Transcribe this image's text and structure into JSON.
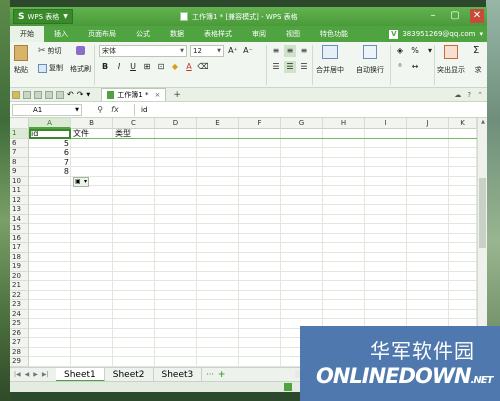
{
  "app": {
    "button_logo": "S",
    "button_label": "WPS 表格",
    "window_title": "工作簿1 * [兼容模式] - WPS 表格"
  },
  "window_controls": {
    "minimize": "–",
    "maximize": "▢",
    "close": "✕"
  },
  "menu": {
    "tabs": [
      "开始",
      "插入",
      "页面布局",
      "公式",
      "数据",
      "表格样式",
      "审阅",
      "视图",
      "特色功能"
    ],
    "active_tab": 0,
    "account_badge": "V",
    "account": "383951269@qq.com"
  },
  "ribbon": {
    "paste": "粘贴",
    "cut": "剪切",
    "copy": "复制",
    "format_painter": "格式刷",
    "font_name": "宋体",
    "font_size": "12",
    "grow_font": "A⁺",
    "shrink_font": "A⁻",
    "bold": "B",
    "italic": "I",
    "underline": "U",
    "merge_center": "合并居中",
    "auto_wrap": "自动换行",
    "percent": "%",
    "highlight": "突出显示",
    "sum": "求"
  },
  "toolbar": {
    "doc_tab": "工作簿1 *",
    "doc_tab_close": "×",
    "new_tab": "+"
  },
  "formula_bar": {
    "name_box": "A1",
    "fx": "fx",
    "content": "id"
  },
  "grid": {
    "columns": [
      "A",
      "B",
      "C",
      "D",
      "E",
      "F",
      "G",
      "H",
      "I",
      "J",
      "K"
    ],
    "rows": [
      "1",
      "6",
      "7",
      "8",
      "9",
      "10",
      "11",
      "12",
      "13",
      "14",
      "15",
      "16",
      "17",
      "18",
      "19",
      "20",
      "21",
      "22",
      "23",
      "24",
      "25",
      "26",
      "27",
      "28",
      "29"
    ],
    "cells": {
      "A1": "id",
      "B1": "文件",
      "C1": "类型",
      "A6": "5",
      "A7": "6",
      "A8": "7",
      "A9": "8"
    }
  },
  "sheets": {
    "tabs": [
      "Sheet1",
      "Sheet2",
      "Sheet3"
    ],
    "active": 0,
    "more": "···",
    "add": "+"
  },
  "watermark": {
    "cn": "华军软件园",
    "en": "ONLINEDOWN",
    "en_suffix": ".NET"
  },
  "colors": {
    "accent": "#4fa340",
    "watermark_bg": "#4f79ae"
  }
}
